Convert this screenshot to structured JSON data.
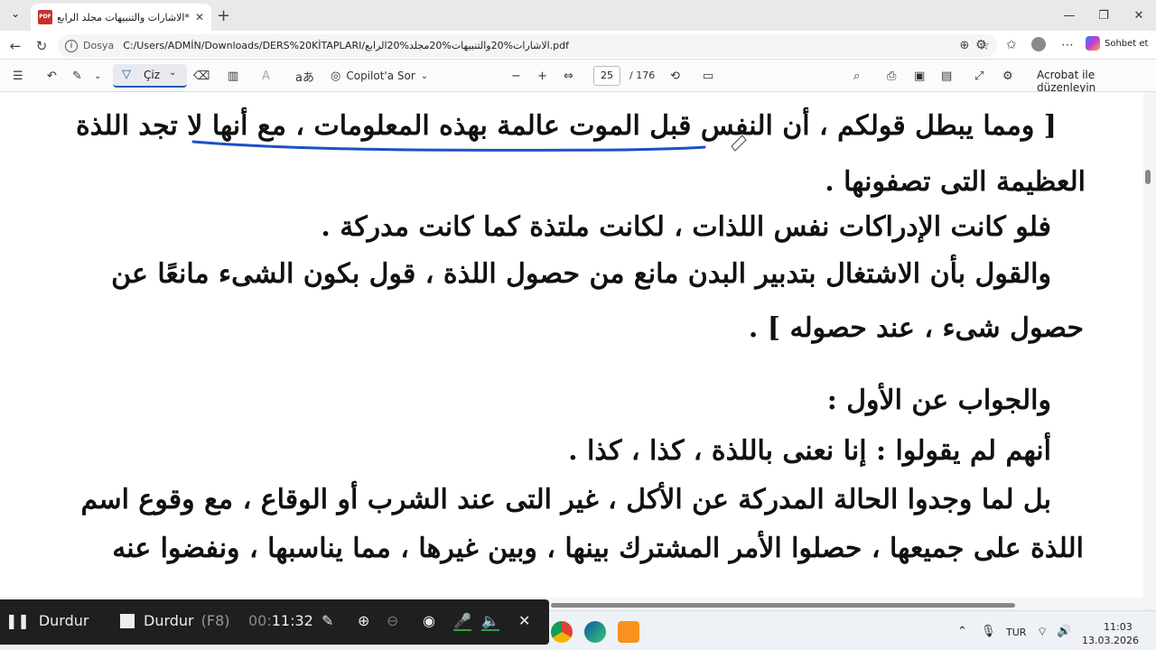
{
  "browser": {
    "tab": {
      "title": "*الاشارات والتنبيهات مجلد الرابع.pdf"
    },
    "address": {
      "protocol_label": "Dosya",
      "url": "C:/Users/ADMİN/Downloads/DERS%20KİTAPLARI/الاشارات%20والتنبيهات%20مجلد%20الرابع.pdf"
    },
    "copilot_label": "Sohbet et"
  },
  "pdf_toolbar": {
    "draw_label": "Çiz",
    "copilot_label": "Copilot'a Sor",
    "page_current": "25",
    "page_total": "/ 176",
    "acrobat_label": "Acrobat ile düzenleyin"
  },
  "document": {
    "lines": [
      "[ ومما يبطل قولكم ، أن النفس قبل الموت عالمة بهذه المعلومات ، مع أنها لا تجد اللذة",
      "العظيمة التى تصفونها .",
      "فلو كانت الإدراكات نفس اللذات ، لكانت ملتذة كما كانت مدركة .",
      "والقول بأن الاشتغال بتدبير البدن مانع من حصول اللذة ، قول بكون الشىء مانعًا عن",
      "حصول شىء ، عند حصوله ] .",
      "والجواب عن الأول :",
      "أنهم لم يقولوا : إنا نعنى باللذة ، كذا ، كذا .",
      "بل لما وجدوا الحالة المدركة عن الأكل ، غير التى عند الشرب أو الوقاع ، مع وقوع اسم",
      "اللذة على جميعها ، حصلوا الأمر المشترك بينها ، وبين غيرها ، مما يناسبها ، ونفضوا عنه"
    ]
  },
  "recorder": {
    "pause_label": "Durdur",
    "stop_label": "Durdur",
    "stop_key": "(F8)",
    "time_prefix": "00:",
    "time": "11:32"
  },
  "taskbar": {
    "language": "TUR",
    "time": "11:03",
    "date": "13.03.2026"
  }
}
